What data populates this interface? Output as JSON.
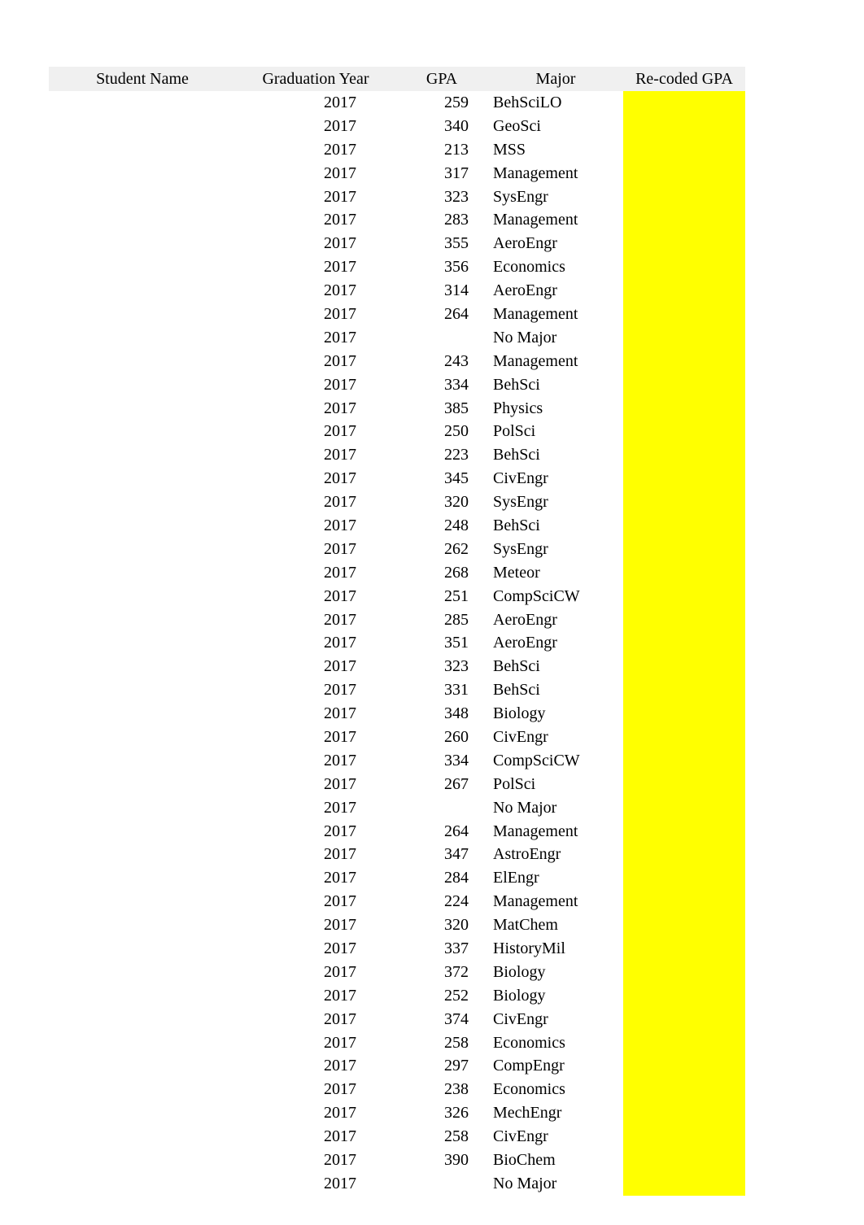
{
  "headers": {
    "name": "Student Name",
    "grad": "Graduation Year",
    "gpa": "GPA",
    "major": "Major",
    "rgpa": "Re-coded GPA"
  },
  "rows": [
    {
      "name": "",
      "grad": "2017",
      "gpa": "259",
      "major": "BehSciLO",
      "rgpa": "",
      "hl": true
    },
    {
      "name": "",
      "grad": "2017",
      "gpa": "340",
      "major": "GeoSci",
      "rgpa": "",
      "hl": true
    },
    {
      "name": "",
      "grad": "2017",
      "gpa": "213",
      "major": "MSS",
      "rgpa": "",
      "hl": true
    },
    {
      "name": "",
      "grad": "2017",
      "gpa": "317",
      "major": "Management",
      "rgpa": "",
      "hl": true
    },
    {
      "name": "",
      "grad": "2017",
      "gpa": "323",
      "major": "SysEngr",
      "rgpa": "",
      "hl": true
    },
    {
      "name": "",
      "grad": "2017",
      "gpa": "283",
      "major": "Management",
      "rgpa": "",
      "hl": true
    },
    {
      "name": "",
      "grad": "2017",
      "gpa": "355",
      "major": "AeroEngr",
      "rgpa": "",
      "hl": true
    },
    {
      "name": "",
      "grad": "2017",
      "gpa": "356",
      "major": "Economics",
      "rgpa": "",
      "hl": true
    },
    {
      "name": "",
      "grad": "2017",
      "gpa": "314",
      "major": "AeroEngr",
      "rgpa": "",
      "hl": true
    },
    {
      "name": "",
      "grad": "2017",
      "gpa": "264",
      "major": "Management",
      "rgpa": "",
      "hl": true
    },
    {
      "name": "",
      "grad": "2017",
      "gpa": "",
      "major": "No Major",
      "rgpa": "",
      "hl": true
    },
    {
      "name": "",
      "grad": "2017",
      "gpa": "243",
      "major": "Management",
      "rgpa": "",
      "hl": true
    },
    {
      "name": "",
      "grad": "2017",
      "gpa": "334",
      "major": "BehSci",
      "rgpa": "",
      "hl": true
    },
    {
      "name": "",
      "grad": "2017",
      "gpa": "385",
      "major": "Physics",
      "rgpa": "",
      "hl": true
    },
    {
      "name": "",
      "grad": "2017",
      "gpa": "250",
      "major": "PolSci",
      "rgpa": "",
      "hl": true
    },
    {
      "name": "",
      "grad": "2017",
      "gpa": "223",
      "major": "BehSci",
      "rgpa": "",
      "hl": true
    },
    {
      "name": "",
      "grad": "2017",
      "gpa": "345",
      "major": "CivEngr",
      "rgpa": "",
      "hl": true
    },
    {
      "name": "",
      "grad": "2017",
      "gpa": "320",
      "major": "SysEngr",
      "rgpa": "",
      "hl": true
    },
    {
      "name": "",
      "grad": "2017",
      "gpa": "248",
      "major": "BehSci",
      "rgpa": "",
      "hl": true
    },
    {
      "name": "",
      "grad": "2017",
      "gpa": "262",
      "major": "SysEngr",
      "rgpa": "",
      "hl": true
    },
    {
      "name": "",
      "grad": "2017",
      "gpa": "268",
      "major": "Meteor",
      "rgpa": "",
      "hl": true
    },
    {
      "name": "",
      "grad": "2017",
      "gpa": "251",
      "major": "CompSciCW",
      "rgpa": "",
      "hl": true
    },
    {
      "name": "",
      "grad": "2017",
      "gpa": "285",
      "major": "AeroEngr",
      "rgpa": "",
      "hl": true
    },
    {
      "name": "",
      "grad": "2017",
      "gpa": "351",
      "major": "AeroEngr",
      "rgpa": "",
      "hl": true
    },
    {
      "name": "",
      "grad": "2017",
      "gpa": "323",
      "major": "BehSci",
      "rgpa": "",
      "hl": true
    },
    {
      "name": "",
      "grad": "2017",
      "gpa": "331",
      "major": "BehSci",
      "rgpa": "",
      "hl": true
    },
    {
      "name": "",
      "grad": "2017",
      "gpa": "348",
      "major": "Biology",
      "rgpa": "",
      "hl": true
    },
    {
      "name": "",
      "grad": "2017",
      "gpa": "260",
      "major": "CivEngr",
      "rgpa": "",
      "hl": true
    },
    {
      "name": "",
      "grad": "2017",
      "gpa": "334",
      "major": "CompSciCW",
      "rgpa": "",
      "hl": true
    },
    {
      "name": "",
      "grad": "2017",
      "gpa": "267",
      "major": "PolSci",
      "rgpa": "",
      "hl": true
    },
    {
      "name": "",
      "grad": "2017",
      "gpa": "",
      "major": "No Major",
      "rgpa": "",
      "hl": true
    },
    {
      "name": "",
      "grad": "2017",
      "gpa": "264",
      "major": "Management",
      "rgpa": "",
      "hl": true
    },
    {
      "name": "",
      "grad": "2017",
      "gpa": "347",
      "major": "AstroEngr",
      "rgpa": "",
      "hl": true
    },
    {
      "name": "",
      "grad": "2017",
      "gpa": "284",
      "major": "ElEngr",
      "rgpa": "",
      "hl": true
    },
    {
      "name": "",
      "grad": "2017",
      "gpa": "224",
      "major": "Management",
      "rgpa": "",
      "hl": true
    },
    {
      "name": "",
      "grad": "2017",
      "gpa": "320",
      "major": "MatChem",
      "rgpa": "",
      "hl": true
    },
    {
      "name": "",
      "grad": "2017",
      "gpa": "337",
      "major": "HistoryMil",
      "rgpa": "",
      "hl": true
    },
    {
      "name": "",
      "grad": "2017",
      "gpa": "372",
      "major": "Biology",
      "rgpa": "",
      "hl": true
    },
    {
      "name": "",
      "grad": "2017",
      "gpa": "252",
      "major": "Biology",
      "rgpa": "",
      "hl": true
    },
    {
      "name": "",
      "grad": "2017",
      "gpa": "374",
      "major": "CivEngr",
      "rgpa": "",
      "hl": true
    },
    {
      "name": "",
      "grad": "2017",
      "gpa": "258",
      "major": "Economics",
      "rgpa": "",
      "hl": true
    },
    {
      "name": "",
      "grad": "2017",
      "gpa": "297",
      "major": "CompEngr",
      "rgpa": "",
      "hl": true
    },
    {
      "name": "",
      "grad": "2017",
      "gpa": "238",
      "major": "Economics",
      "rgpa": "",
      "hl": true
    },
    {
      "name": "",
      "grad": "2017",
      "gpa": "326",
      "major": "MechEngr",
      "rgpa": "",
      "hl": true
    },
    {
      "name": "",
      "grad": "2017",
      "gpa": "258",
      "major": "CivEngr",
      "rgpa": "",
      "hl": true
    },
    {
      "name": "",
      "grad": "2017",
      "gpa": "390",
      "major": "BioChem",
      "rgpa": "",
      "hl": true
    },
    {
      "name": "",
      "grad": "2017",
      "gpa": "",
      "major": "No Major",
      "rgpa": "",
      "hl": true
    }
  ]
}
